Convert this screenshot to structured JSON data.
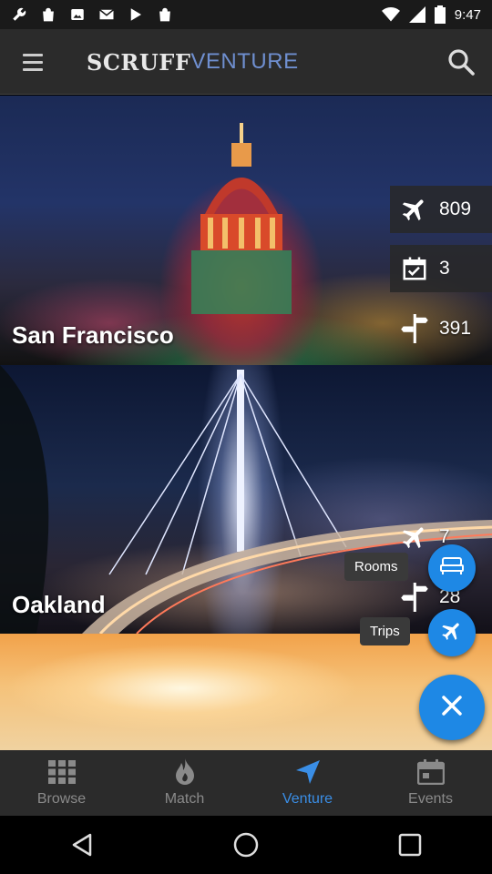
{
  "status_bar": {
    "time": "9:47",
    "icons": [
      "wrench-icon",
      "bag-icon",
      "image-icon",
      "gmail-icon",
      "play-icon",
      "bag-icon",
      "wifi-icon",
      "signal-icon",
      "battery-icon"
    ]
  },
  "app_bar": {
    "logo_bold": "SCRUFF",
    "logo_light": "VENTURE",
    "menu_icon": "menu-icon",
    "search_icon": "search-icon"
  },
  "cards": [
    {
      "city": "San Francisco",
      "stats": [
        {
          "icon": "airplane-icon",
          "value": "809"
        },
        {
          "icon": "calendar-check-icon",
          "value": "3"
        },
        {
          "icon": "signpost-icon",
          "value": "391"
        }
      ]
    },
    {
      "city": "Oakland",
      "stats": [
        {
          "icon": "airplane-icon",
          "value": "7"
        },
        {
          "icon": "signpost-icon",
          "value": "28"
        }
      ]
    }
  ],
  "fab_menu": {
    "rooms_label": "Rooms",
    "trips_label": "Trips",
    "rooms_icon": "bed-icon",
    "trips_icon": "airplane-icon",
    "close_icon": "close-icon"
  },
  "tabs": [
    {
      "label": "Browse",
      "icon": "grid-icon",
      "active": false
    },
    {
      "label": "Match",
      "icon": "flame-icon",
      "active": false
    },
    {
      "label": "Venture",
      "icon": "navigation-arrow-icon",
      "active": true
    },
    {
      "label": "Events",
      "icon": "calendar-icon",
      "active": false
    }
  ],
  "colors": {
    "accent": "#1e88e5",
    "active_tab": "#3a8ee6",
    "inactive_tab": "#8a8a8a",
    "bar_bg": "#2b2b2b"
  }
}
